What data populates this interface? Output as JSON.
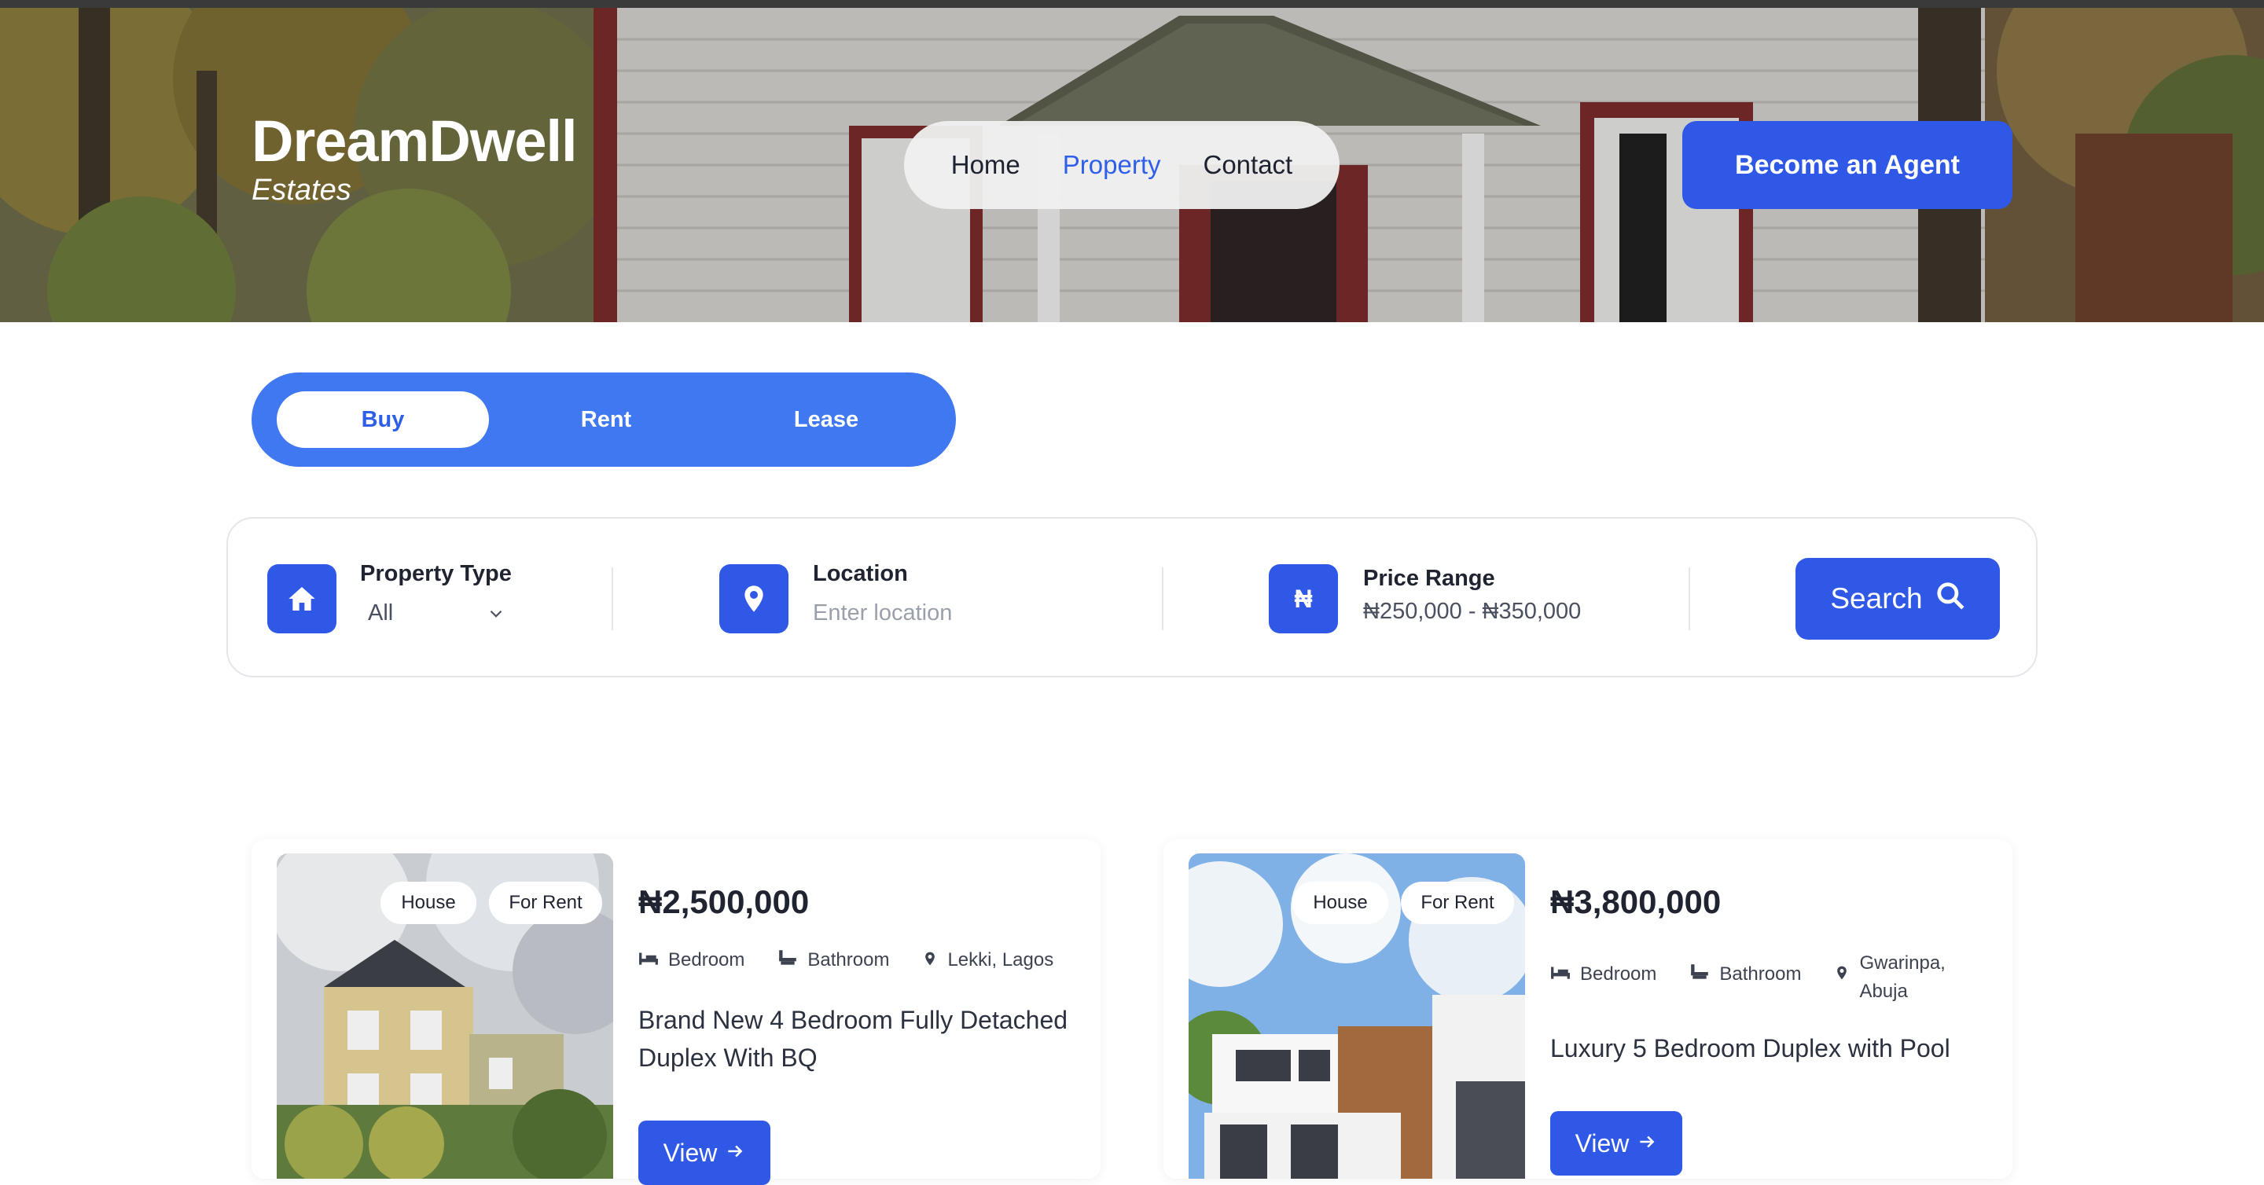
{
  "brand": {
    "name": "DreamDwell",
    "sub": "Estates"
  },
  "nav": {
    "items": [
      {
        "label": "Home",
        "active": false
      },
      {
        "label": "Property",
        "active": true
      },
      {
        "label": "Contact",
        "active": false
      }
    ]
  },
  "header": {
    "agent_button": "Become an Agent"
  },
  "tabs": [
    {
      "label": "Buy",
      "active": true
    },
    {
      "label": "Rent",
      "active": false
    },
    {
      "label": "Lease",
      "active": false
    }
  ],
  "search": {
    "property_type": {
      "label": "Property Type",
      "value": "All"
    },
    "location": {
      "label": "Location",
      "placeholder": "Enter location"
    },
    "price_range": {
      "label": "Price Range",
      "value": "₦250,000 - ₦350,000",
      "icon_text": "₦"
    },
    "button": "Search"
  },
  "listings": [
    {
      "badges": [
        "House",
        "For Rent"
      ],
      "price": "₦2,500,000",
      "bedroom": "Bedroom",
      "bathroom": "Bathroom",
      "location": "Lekki, Lagos",
      "title": "Brand New 4 Bedroom Fully Detached Duplex With BQ",
      "view": "View"
    },
    {
      "badges": [
        "House",
        "For Rent"
      ],
      "price": "₦3,800,000",
      "bedroom": "Bedroom",
      "bathroom": "Bathroom",
      "location_line1": "Gwarinpa,",
      "location_line2": "Abuja",
      "title": "Luxury 5 Bedroom Duplex with Pool",
      "view": "View"
    }
  ],
  "colors": {
    "accent": "#2f58e6",
    "tabs_bg": "#3f78f0",
    "nav_active": "#2f5fe8"
  }
}
